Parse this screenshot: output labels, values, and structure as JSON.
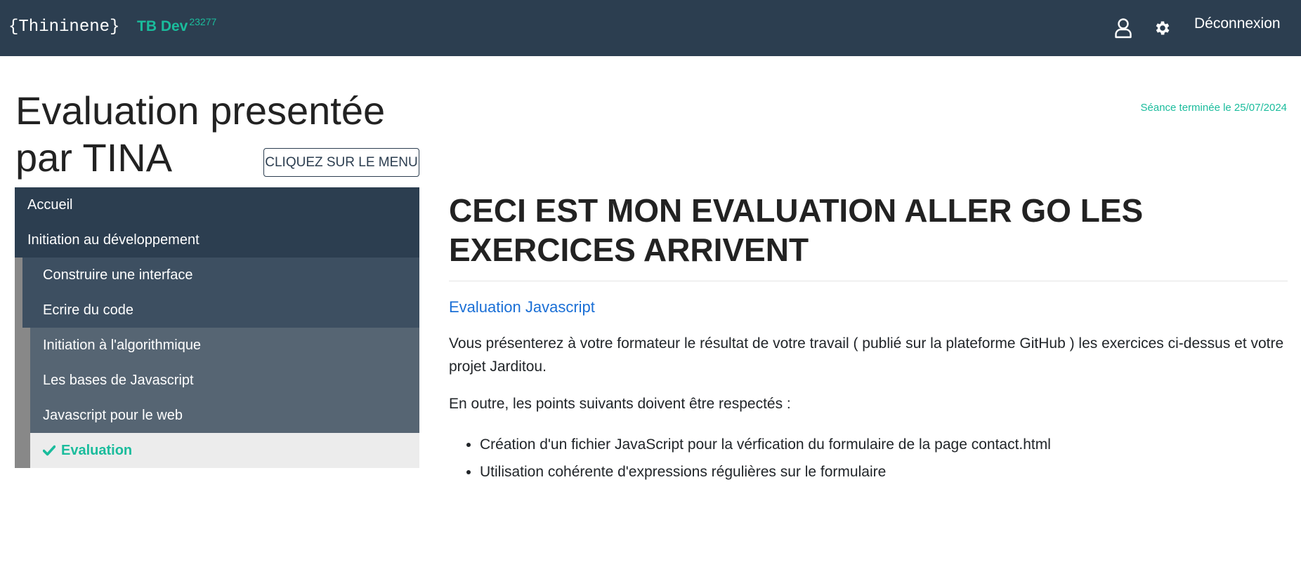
{
  "header": {
    "brand": "{Thininene}",
    "project": "TB Dev",
    "project_id": "23277",
    "logout_label": "Déconnexion",
    "accent_color": "#1abc9c",
    "bar_color": "#2c3e50"
  },
  "page": {
    "title": "Evaluation presentée par TINA",
    "menu_button": "CLIQUEZ SUR LE MENU",
    "session_status": "Séance terminée le 25/07/2024"
  },
  "nav": {
    "items": [
      {
        "label": "Accueil"
      },
      {
        "label": "Initiation au développement"
      },
      {
        "label": "Construire une interface"
      },
      {
        "label": "Ecrire du code"
      },
      {
        "label": "Initiation à l'algorithmique"
      },
      {
        "label": "Les bases de Javascript"
      },
      {
        "label": "Javascript pour le web"
      },
      {
        "label": "Evaluation",
        "icon": "check-icon",
        "active": true
      }
    ]
  },
  "content": {
    "heading": "CECI EST MON EVALUATION ALLER GO LES EXERCICES ARRIVENT",
    "link": "Evaluation Javascript",
    "paragraph1": "Vous présenterez à votre formateur le résultat de votre travail ( publié sur la plateforme GitHub ) les exercices ci-dessus et votre projet Jarditou.",
    "paragraph2": "En outre, les points suivants doivent être respectés :",
    "points": [
      "Création d'un fichier JavaScript pour la vérfication du formulaire de la page contact.html",
      "Utilisation cohérente d'expressions régulières sur le formulaire"
    ]
  }
}
